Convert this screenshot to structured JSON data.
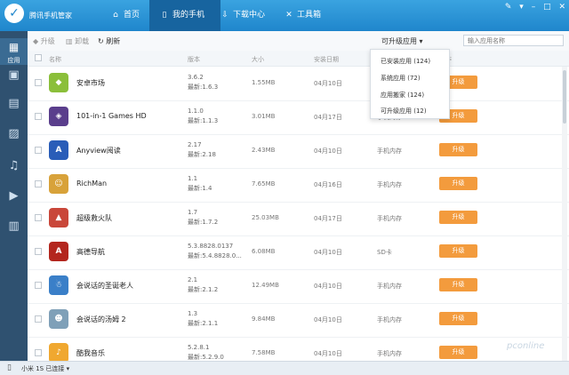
{
  "app": {
    "title": "腾讯手机管家"
  },
  "nav": [
    {
      "label": "首页",
      "icon": "home-icon"
    },
    {
      "label": "我的手机",
      "icon": "phone-icon"
    },
    {
      "label": "下载中心",
      "icon": "download-icon"
    },
    {
      "label": "工具箱",
      "icon": "toolbox-icon"
    }
  ],
  "sidebar": {
    "active_label": "应用"
  },
  "toolbar": {
    "upgrade_label": "升级",
    "delete_label": "卸载",
    "refresh_label": "刷新",
    "filter_label": "可升级应用",
    "search_placeholder": "输入应用名称"
  },
  "table": {
    "columns": [
      "名称",
      "版本",
      "大小",
      "安装日期",
      "位置",
      "操作"
    ],
    "rows": [
      {
        "name": "安卓市场",
        "ver1": "3.6.2",
        "ver2": "最新:1.6.3",
        "size": "1.55MB",
        "date": "04月10日",
        "loc": "",
        "action": "升级"
      },
      {
        "name": "101-in-1 Games HD",
        "ver1": "1.1.0",
        "ver2": "最新:1.1.3",
        "size": "3.01MB",
        "date": "04月17日",
        "loc": "手机内存",
        "action": "升级"
      },
      {
        "name": "Anyview阅读",
        "ver1": "2.17",
        "ver2": "最新:2.18",
        "size": "2.43MB",
        "date": "04月10日",
        "loc": "手机内存",
        "action": "升级"
      },
      {
        "name": "RichMan",
        "ver1": "1.1",
        "ver2": "最新:1.4",
        "size": "7.65MB",
        "date": "04月16日",
        "loc": "手机内存",
        "action": "升级"
      },
      {
        "name": "超级救火队",
        "ver1": "1.7",
        "ver2": "最新:1.7.2",
        "size": "25.03MB",
        "date": "04月17日",
        "loc": "手机内存",
        "action": "升级"
      },
      {
        "name": "高德导航",
        "ver1": "5.3.8828.0137",
        "ver2": "最新:5.4.8828.0...",
        "size": "6.08MB",
        "date": "04月10日",
        "loc": "SD卡",
        "action": "升级"
      },
      {
        "name": "会说话的圣诞老人",
        "ver1": "2.1",
        "ver2": "最新:2.1.2",
        "size": "12.49MB",
        "date": "04月10日",
        "loc": "手机内存",
        "action": "升级"
      },
      {
        "name": "会说话的汤姆 2",
        "ver1": "1.3",
        "ver2": "最新:2.1.1",
        "size": "9.84MB",
        "date": "04月10日",
        "loc": "手机内存",
        "action": "升级"
      },
      {
        "name": "酷我音乐",
        "ver1": "5.2.8.1",
        "ver2": "最新:5.2.9.0",
        "size": "7.58MB",
        "date": "04月10日",
        "loc": "手机内存",
        "action": "升级"
      }
    ]
  },
  "dropdown": {
    "items": [
      "已安装应用 (124)",
      "系统应用 (72)",
      "应用搬家 (124)",
      "可升级应用 (12)"
    ]
  },
  "status": {
    "text": "小米 1S  已连接 ▾"
  },
  "watermark": "pconline"
}
